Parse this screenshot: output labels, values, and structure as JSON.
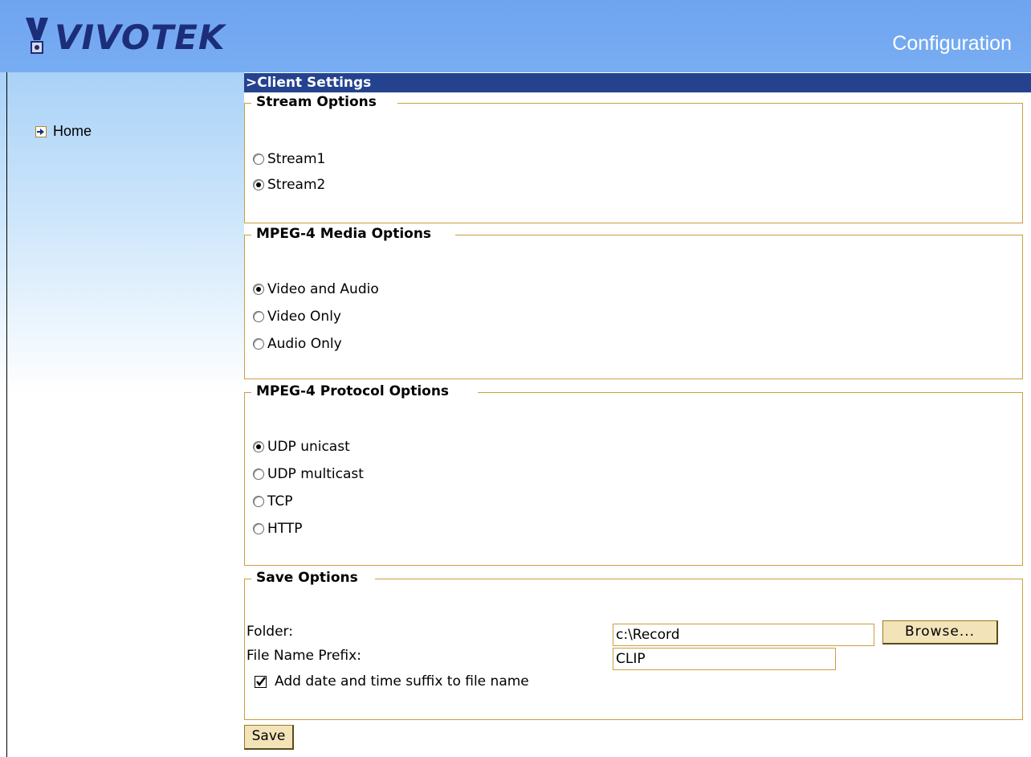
{
  "header": {
    "logo_text": "VIVOTEK",
    "section_title": "Configuration",
    "colors": {
      "header_bg": "#72a8f1",
      "title_bar": "#24428e",
      "group_border": "#c8a040",
      "logo_text": "#1c2d7a"
    }
  },
  "sidebar": {
    "home_label": "Home",
    "home_icon": "arrow-right-icon"
  },
  "main": {
    "title": ">Client Settings",
    "stream_options": {
      "legend": "Stream Options",
      "options": [
        {
          "label": "Stream1",
          "selected": false
        },
        {
          "label": "Stream2",
          "selected": true
        }
      ]
    },
    "media_options": {
      "legend": "MPEG-4 Media Options",
      "options": [
        {
          "label": "Video and Audio",
          "selected": true
        },
        {
          "label": "Video Only",
          "selected": false
        },
        {
          "label": "Audio Only",
          "selected": false
        }
      ]
    },
    "protocol_options": {
      "legend": "MPEG-4 Protocol Options",
      "options": [
        {
          "label": "UDP unicast",
          "selected": true
        },
        {
          "label": "UDP multicast",
          "selected": false
        },
        {
          "label": "TCP",
          "selected": false
        },
        {
          "label": "HTTP",
          "selected": false
        }
      ]
    },
    "save_options": {
      "legend": "Save Options",
      "folder_label": "Folder:",
      "folder_value": "c:\\Record",
      "browse_label": "Browse...",
      "prefix_label": "File Name Prefix:",
      "prefix_value": "CLIP",
      "suffix_label": "Add date and time suffix to file name",
      "suffix_checked": true
    },
    "save_button": "Save"
  }
}
